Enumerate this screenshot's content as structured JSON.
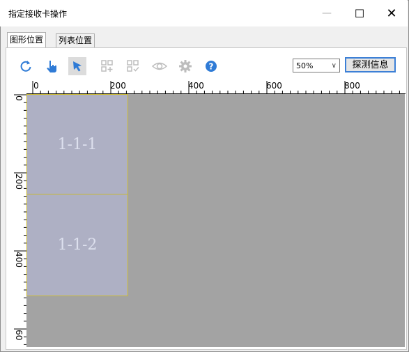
{
  "window": {
    "title": "指定接收卡操作",
    "minimize_glyph": "—",
    "maximize_glyph": "☐",
    "close_glyph": "✕"
  },
  "tabs": [
    {
      "label": "图形位置",
      "active": true
    },
    {
      "label": "列表位置",
      "active": false
    }
  ],
  "toolbar": {
    "icons": [
      "refresh-icon",
      "hand-pointer-icon",
      "select-arrow-icon",
      "add-grid-icon",
      "check-grid-icon",
      "eye-icon",
      "gear-icon",
      "help-icon"
    ],
    "zoom_value": "50%",
    "zoom_arrow": "∨",
    "probe_label": "探测信息",
    "accent_color": "#2f7bd6"
  },
  "ruler": {
    "horizontal_labels": [
      "0",
      "200",
      "400",
      "600",
      "800"
    ],
    "vertical_labels": [
      "0",
      "200",
      "400",
      "60"
    ]
  },
  "cards": [
    {
      "label": "1-1-1"
    },
    {
      "label": "1-1-2"
    }
  ],
  "colors": {
    "canvas": "#a3a3a3",
    "card_fill": "#aeb0c4",
    "card_border": "#c9b832"
  }
}
